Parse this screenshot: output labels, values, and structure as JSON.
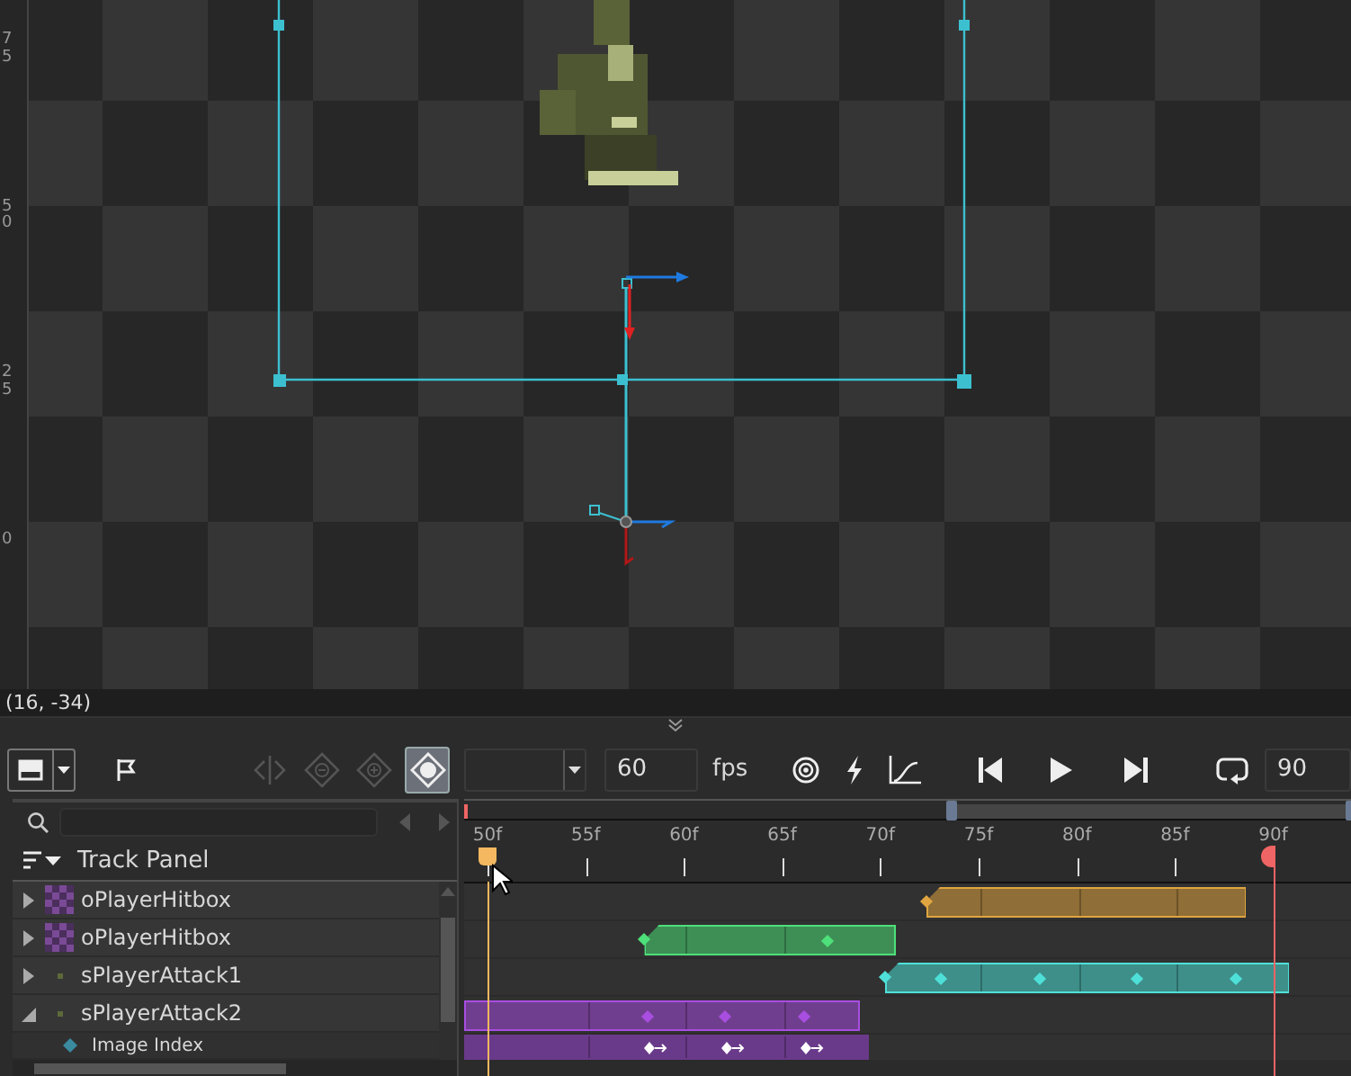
{
  "canvas": {
    "ruler_labels": [
      "75",
      "50",
      "25",
      "0"
    ]
  },
  "status_bar": {
    "coordinates": "(16, -34)"
  },
  "toolbar": {
    "tools": [
      {
        "kind": "view",
        "disabled": false,
        "selected": false
      },
      {
        "kind": "flag",
        "disabled": false,
        "selected": false
      },
      {
        "kind": "split",
        "disabled": true,
        "selected": false
      },
      {
        "kind": "remove-key",
        "disabled": true,
        "selected": false
      },
      {
        "kind": "add-key",
        "disabled": true,
        "selected": false
      },
      {
        "kind": "key",
        "disabled": false,
        "selected": true
      }
    ],
    "fps_value": "60",
    "fps_label": "fps",
    "length_value": "90"
  },
  "track_panel": {
    "title": "Track Panel",
    "tracks": [
      {
        "name": "oPlayerHitbox",
        "kind": "object",
        "expanded": false,
        "color": "#e0a540"
      },
      {
        "name": "oPlayerHitbox",
        "kind": "object",
        "expanded": false,
        "color": "#4ee07a"
      },
      {
        "name": "sPlayerAttack1",
        "kind": "sprite",
        "expanded": false,
        "color": "#4ee0d8"
      },
      {
        "name": "sPlayerAttack2",
        "kind": "sprite",
        "expanded": true,
        "color": "#a84ee0",
        "children": [
          {
            "name": "Image Index",
            "kind": "property",
            "color": "#6a3a8a"
          }
        ]
      }
    ]
  },
  "timeline": {
    "range_slider": {
      "level": 0.45
    },
    "ticks": [
      "50f",
      "55f",
      "60f",
      "65f",
      "70f",
      "75f",
      "80f",
      "85f",
      "90f"
    ]
  }
}
